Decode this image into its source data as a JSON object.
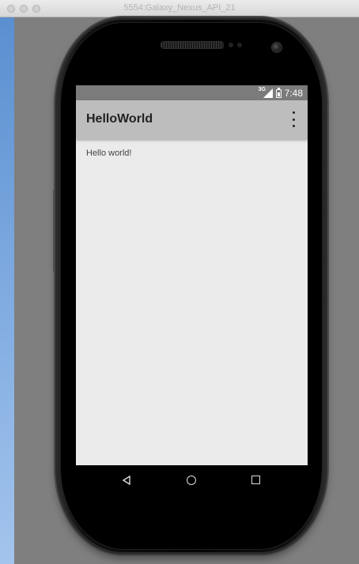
{
  "window": {
    "title": "5554:Galaxy_Nexus_API_21"
  },
  "statusbar": {
    "network": "3G",
    "time": "7:48"
  },
  "app": {
    "title": "HelloWorld",
    "content_text": "Hello world!"
  },
  "icons": {
    "overflow": "overflow-menu-icon",
    "back": "back-icon",
    "home": "home-icon",
    "recent": "recent-apps-icon"
  }
}
